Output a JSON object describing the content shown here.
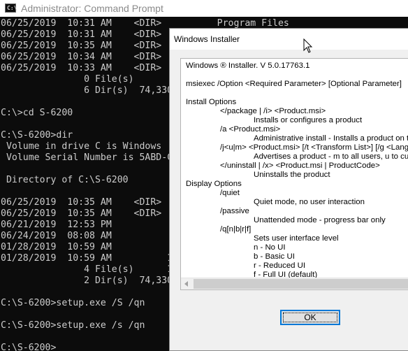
{
  "cmd_window": {
    "title": "Administrator: Command Prompt",
    "icon": "command-prompt-icon",
    "icon_glyph": "C:\\",
    "lines": [
      "06/25/2019  10:31 AM    <DIR>          Program Files",
      "06/25/2019  10:31 AM    <DIR>",
      "06/25/2019  10:35 AM    <DIR>",
      "06/25/2019  10:34 AM    <DIR>",
      "06/25/2019  10:33 AM    <DIR>",
      "               0 File(s)",
      "               6 Dir(s)  74,330",
      "",
      "C:\\>cd S-6200",
      "",
      "C:\\S-6200>dir",
      " Volume in drive C is Windows",
      " Volume Serial Number is 5ABD-C",
      "",
      " Directory of C:\\S-6200",
      "",
      "06/25/2019  10:35 AM    <DIR>",
      "06/25/2019  10:35 AM    <DIR>",
      "06/21/2019  12:53 PM",
      "06/24/2019  08:08 AM",
      "01/28/2019  10:59 AM",
      "01/28/2019  10:59 AM          18",
      "               4 File(s)      18",
      "               2 Dir(s)  74,330",
      "",
      "C:\\S-6200>setup.exe /S /qn",
      "",
      "C:\\S-6200>setup.exe /s /qn",
      "",
      "C:\\S-6200>"
    ]
  },
  "installer_dialog": {
    "title": "Windows Installer",
    "help_lines": [
      {
        "text": "Windows ® Installer. V 5.0.17763.1",
        "indent": 0
      },
      {
        "text": "",
        "indent": 0
      },
      {
        "text": "msiexec /Option <Required Parameter> [Optional Parameter]",
        "indent": 0
      },
      {
        "text": "",
        "indent": 0
      },
      {
        "text": "Install Options",
        "indent": 0
      },
      {
        "text": "</package | /i> <Product.msi>",
        "indent": 1
      },
      {
        "text": "Installs or configures a product",
        "indent": 2
      },
      {
        "text": "/a <Product.msi>",
        "indent": 1
      },
      {
        "text": "Administrative install - Installs a product on the n",
        "indent": 2
      },
      {
        "text": "/j<u|m> <Product.msi> [/t <Transform List>] [/g <Languag",
        "indent": 1
      },
      {
        "text": "Advertises a product - m to all users, u to curren",
        "indent": 2
      },
      {
        "text": "</uninstall | /x> <Product.msi | ProductCode>",
        "indent": 1
      },
      {
        "text": "Uninstalls the product",
        "indent": 2
      },
      {
        "text": "Display Options",
        "indent": 0
      },
      {
        "text": "/quiet",
        "indent": 1
      },
      {
        "text": "Quiet mode, no user interaction",
        "indent": 2
      },
      {
        "text": "/passive",
        "indent": 1
      },
      {
        "text": "Unattended mode - progress bar only",
        "indent": 2
      },
      {
        "text": "/q[n|b|r|f]",
        "indent": 1
      },
      {
        "text": "Sets user interface level",
        "indent": 2
      },
      {
        "text": "n - No UI",
        "indent": 2
      },
      {
        "text": "b - Basic UI",
        "indent": 2
      },
      {
        "text": "r - Reduced UI",
        "indent": 2
      },
      {
        "text": "f - Full UI (default)",
        "indent": 2
      }
    ],
    "ok_label": "OK"
  },
  "colors": {
    "console_bg": "#0c0c0c",
    "console_text": "#cccccc",
    "dialog_bg": "#f0f0f0",
    "focus_border": "#0078d7"
  }
}
